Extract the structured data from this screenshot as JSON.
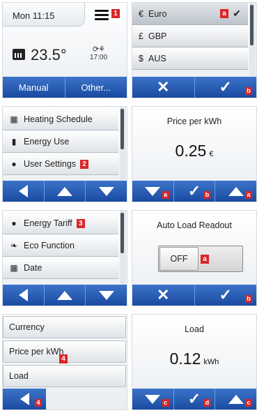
{
  "screen1": {
    "time": "Mon 11:15",
    "menu_badge": "1",
    "temperature": "23.5°",
    "next_time": "17:00",
    "buttons": {
      "manual": "Manual",
      "other": "Other..."
    }
  },
  "screen2": {
    "currencies": [
      {
        "symbol": "€",
        "label": "Euro"
      },
      {
        "symbol": "£",
        "label": "GBP"
      },
      {
        "symbol": "$",
        "label": "AUS"
      }
    ],
    "selected_badge": "a",
    "check_badge": "b"
  },
  "screen3": {
    "items": [
      {
        "icon": "heating-schedule-icon",
        "label": "Heating Schedule"
      },
      {
        "icon": "energy-use-icon",
        "label": "Energy Use"
      },
      {
        "icon": "user-icon",
        "label": "User Settings",
        "badge": "2"
      }
    ]
  },
  "screen4": {
    "title": "Price per kWh",
    "value": "0.25",
    "unit": "€",
    "badges": {
      "down": "a",
      "check": "b",
      "up": "a"
    }
  },
  "screen5": {
    "items": [
      {
        "icon": "energy-tariff-icon",
        "label": "Energy Tariff",
        "badge": "3"
      },
      {
        "icon": "leaf-icon",
        "label": "Eco Function"
      },
      {
        "icon": "calendar-icon",
        "label": "Date"
      }
    ]
  },
  "screen6": {
    "title": "Auto Load Readout",
    "toggle_label": "OFF",
    "toggle_badge": "a",
    "check_badge": "b"
  },
  "screen7": {
    "items": [
      {
        "label": "Currency"
      },
      {
        "label": "Price per kWh",
        "badge": "4"
      },
      {
        "label": "Load"
      }
    ],
    "back_badge": "4"
  },
  "screen8": {
    "title": "Load",
    "value": "0.12",
    "unit": "kWh",
    "badges": {
      "down": "c",
      "check": "d",
      "up": "c"
    }
  }
}
